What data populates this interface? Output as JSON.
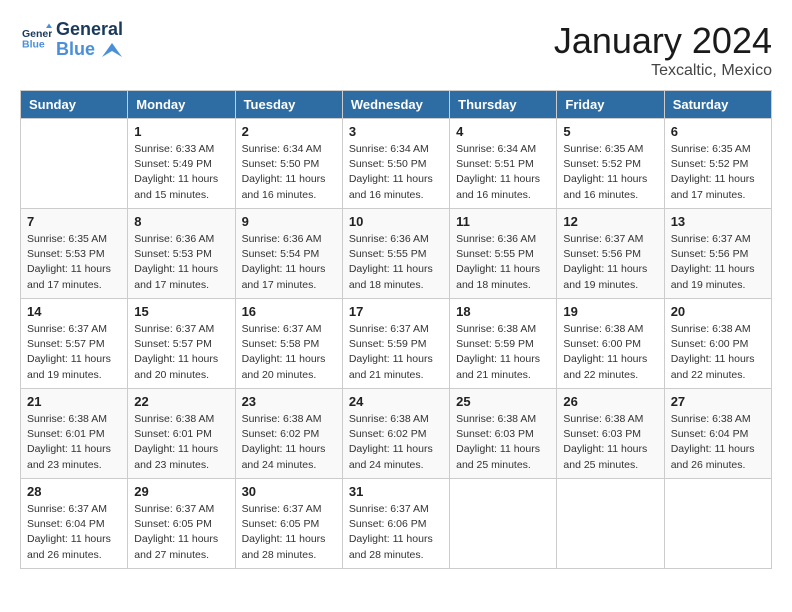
{
  "header": {
    "logo_line1": "General",
    "logo_line2": "Blue",
    "month_title": "January 2024",
    "location": "Texcaltic, Mexico"
  },
  "weekdays": [
    "Sunday",
    "Monday",
    "Tuesday",
    "Wednesday",
    "Thursday",
    "Friday",
    "Saturday"
  ],
  "weeks": [
    [
      {
        "day": "",
        "info": ""
      },
      {
        "day": "1",
        "info": "Sunrise: 6:33 AM\nSunset: 5:49 PM\nDaylight: 11 hours\nand 15 minutes."
      },
      {
        "day": "2",
        "info": "Sunrise: 6:34 AM\nSunset: 5:50 PM\nDaylight: 11 hours\nand 16 minutes."
      },
      {
        "day": "3",
        "info": "Sunrise: 6:34 AM\nSunset: 5:50 PM\nDaylight: 11 hours\nand 16 minutes."
      },
      {
        "day": "4",
        "info": "Sunrise: 6:34 AM\nSunset: 5:51 PM\nDaylight: 11 hours\nand 16 minutes."
      },
      {
        "day": "5",
        "info": "Sunrise: 6:35 AM\nSunset: 5:52 PM\nDaylight: 11 hours\nand 16 minutes."
      },
      {
        "day": "6",
        "info": "Sunrise: 6:35 AM\nSunset: 5:52 PM\nDaylight: 11 hours\nand 17 minutes."
      }
    ],
    [
      {
        "day": "7",
        "info": "Sunrise: 6:35 AM\nSunset: 5:53 PM\nDaylight: 11 hours\nand 17 minutes."
      },
      {
        "day": "8",
        "info": "Sunrise: 6:36 AM\nSunset: 5:53 PM\nDaylight: 11 hours\nand 17 minutes."
      },
      {
        "day": "9",
        "info": "Sunrise: 6:36 AM\nSunset: 5:54 PM\nDaylight: 11 hours\nand 17 minutes."
      },
      {
        "day": "10",
        "info": "Sunrise: 6:36 AM\nSunset: 5:55 PM\nDaylight: 11 hours\nand 18 minutes."
      },
      {
        "day": "11",
        "info": "Sunrise: 6:36 AM\nSunset: 5:55 PM\nDaylight: 11 hours\nand 18 minutes."
      },
      {
        "day": "12",
        "info": "Sunrise: 6:37 AM\nSunset: 5:56 PM\nDaylight: 11 hours\nand 19 minutes."
      },
      {
        "day": "13",
        "info": "Sunrise: 6:37 AM\nSunset: 5:56 PM\nDaylight: 11 hours\nand 19 minutes."
      }
    ],
    [
      {
        "day": "14",
        "info": "Sunrise: 6:37 AM\nSunset: 5:57 PM\nDaylight: 11 hours\nand 19 minutes."
      },
      {
        "day": "15",
        "info": "Sunrise: 6:37 AM\nSunset: 5:57 PM\nDaylight: 11 hours\nand 20 minutes."
      },
      {
        "day": "16",
        "info": "Sunrise: 6:37 AM\nSunset: 5:58 PM\nDaylight: 11 hours\nand 20 minutes."
      },
      {
        "day": "17",
        "info": "Sunrise: 6:37 AM\nSunset: 5:59 PM\nDaylight: 11 hours\nand 21 minutes."
      },
      {
        "day": "18",
        "info": "Sunrise: 6:38 AM\nSunset: 5:59 PM\nDaylight: 11 hours\nand 21 minutes."
      },
      {
        "day": "19",
        "info": "Sunrise: 6:38 AM\nSunset: 6:00 PM\nDaylight: 11 hours\nand 22 minutes."
      },
      {
        "day": "20",
        "info": "Sunrise: 6:38 AM\nSunset: 6:00 PM\nDaylight: 11 hours\nand 22 minutes."
      }
    ],
    [
      {
        "day": "21",
        "info": "Sunrise: 6:38 AM\nSunset: 6:01 PM\nDaylight: 11 hours\nand 23 minutes."
      },
      {
        "day": "22",
        "info": "Sunrise: 6:38 AM\nSunset: 6:01 PM\nDaylight: 11 hours\nand 23 minutes."
      },
      {
        "day": "23",
        "info": "Sunrise: 6:38 AM\nSunset: 6:02 PM\nDaylight: 11 hours\nand 24 minutes."
      },
      {
        "day": "24",
        "info": "Sunrise: 6:38 AM\nSunset: 6:02 PM\nDaylight: 11 hours\nand 24 minutes."
      },
      {
        "day": "25",
        "info": "Sunrise: 6:38 AM\nSunset: 6:03 PM\nDaylight: 11 hours\nand 25 minutes."
      },
      {
        "day": "26",
        "info": "Sunrise: 6:38 AM\nSunset: 6:03 PM\nDaylight: 11 hours\nand 25 minutes."
      },
      {
        "day": "27",
        "info": "Sunrise: 6:38 AM\nSunset: 6:04 PM\nDaylight: 11 hours\nand 26 minutes."
      }
    ],
    [
      {
        "day": "28",
        "info": "Sunrise: 6:37 AM\nSunset: 6:04 PM\nDaylight: 11 hours\nand 26 minutes."
      },
      {
        "day": "29",
        "info": "Sunrise: 6:37 AM\nSunset: 6:05 PM\nDaylight: 11 hours\nand 27 minutes."
      },
      {
        "day": "30",
        "info": "Sunrise: 6:37 AM\nSunset: 6:05 PM\nDaylight: 11 hours\nand 28 minutes."
      },
      {
        "day": "31",
        "info": "Sunrise: 6:37 AM\nSunset: 6:06 PM\nDaylight: 11 hours\nand 28 minutes."
      },
      {
        "day": "",
        "info": ""
      },
      {
        "day": "",
        "info": ""
      },
      {
        "day": "",
        "info": ""
      }
    ]
  ]
}
